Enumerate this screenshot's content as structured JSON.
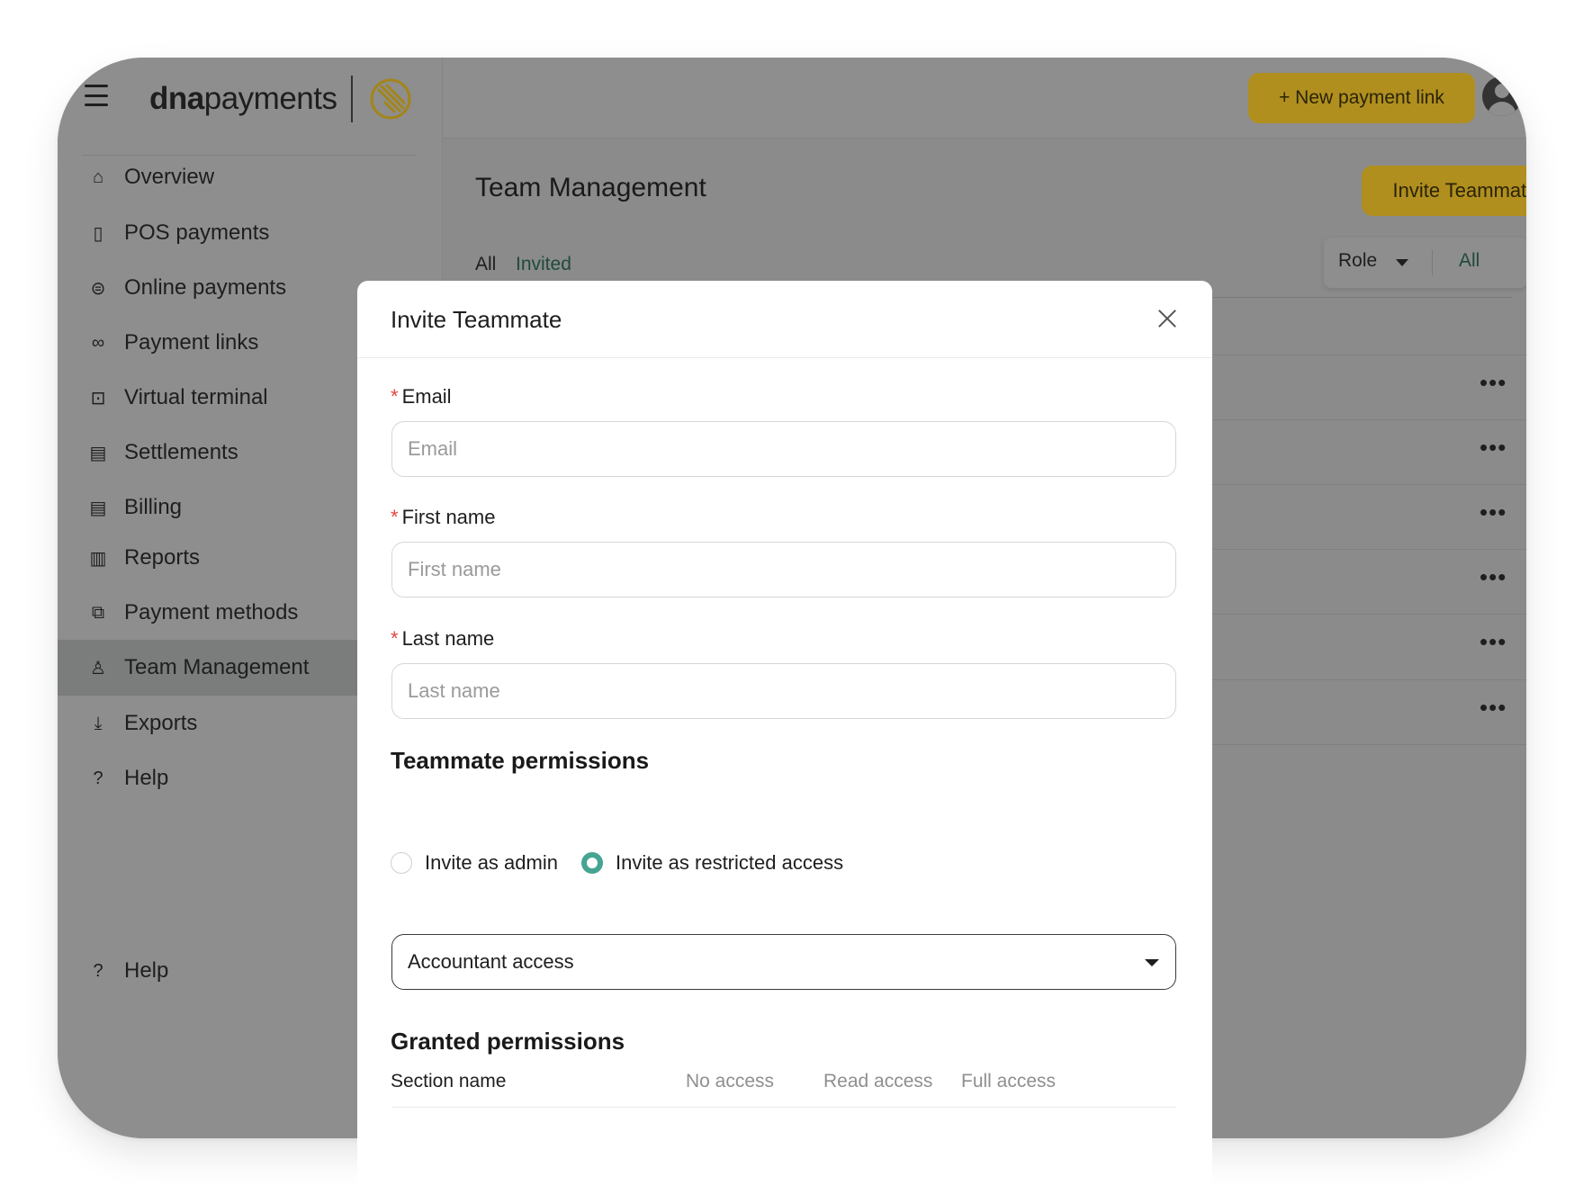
{
  "sidebar": {
    "logo": {
      "word_bold": "dna",
      "word_light": "payments"
    },
    "items": [
      {
        "label": "Overview",
        "icon": "home-icon",
        "glyph": "⌂"
      },
      {
        "label": "POS payments",
        "icon": "pos-terminal-icon",
        "glyph": "▯"
      },
      {
        "label": "Online payments",
        "icon": "online-payment-icon",
        "glyph": "⊜"
      },
      {
        "label": "Payment links",
        "icon": "link-icon",
        "glyph": "∞"
      },
      {
        "label": "Virtual terminal",
        "icon": "terminal-icon",
        "glyph": "⊡"
      },
      {
        "label": "Settlements",
        "icon": "document-icon",
        "glyph": "▤"
      },
      {
        "label": "Billing",
        "icon": "billing-icon",
        "glyph": "▤"
      },
      {
        "label": "Reports",
        "icon": "report-icon",
        "glyph": "▥"
      },
      {
        "label": "Payment methods",
        "icon": "payment-methods-icon",
        "glyph": "⧉"
      },
      {
        "label": "Team Management",
        "icon": "team-icon",
        "glyph": "♙"
      },
      {
        "label": "Exports",
        "icon": "download-icon",
        "glyph": "⤓"
      },
      {
        "label": "Help",
        "icon": "help-icon",
        "glyph": "?"
      }
    ],
    "active_index": 9,
    "bottom_help": {
      "label": "Help",
      "icon": "help-icon",
      "glyph": "?"
    }
  },
  "topbar": {
    "new_payment_link": "+ New payment link",
    "avatar_icon": "user-avatar-icon"
  },
  "main": {
    "title": "Team Management",
    "invite_button": "Invite Teammate",
    "tabs": [
      "All",
      "Invited"
    ],
    "active_tab": "Invited",
    "filter": {
      "role_label": "Role",
      "value": "All"
    },
    "row_actions": "•••"
  },
  "modal": {
    "title": "Invite Teammate",
    "required_mark": "*",
    "fields": {
      "email": {
        "label": "Email",
        "placeholder": "Email",
        "value": ""
      },
      "first_name": {
        "label": "First name",
        "placeholder": "First name",
        "value": ""
      },
      "last_name": {
        "label": "Last name",
        "placeholder": "Last name",
        "value": ""
      }
    },
    "permissions_heading": "Teammate permissions",
    "radio_options": [
      "Invite as admin",
      "Invite as restricted access"
    ],
    "selected_radio": "Invite as restricted access",
    "access_select": "Accountant access",
    "granted_heading": "Granted permissions",
    "table_headers": [
      "Section name",
      "No access",
      "Read access",
      "Full access"
    ]
  },
  "colors": {
    "accent_yellow": "#b08f1f",
    "accent_teal": "#46a492",
    "required_red": "#e0483e",
    "overlay_gray": "#8e8e8e"
  }
}
